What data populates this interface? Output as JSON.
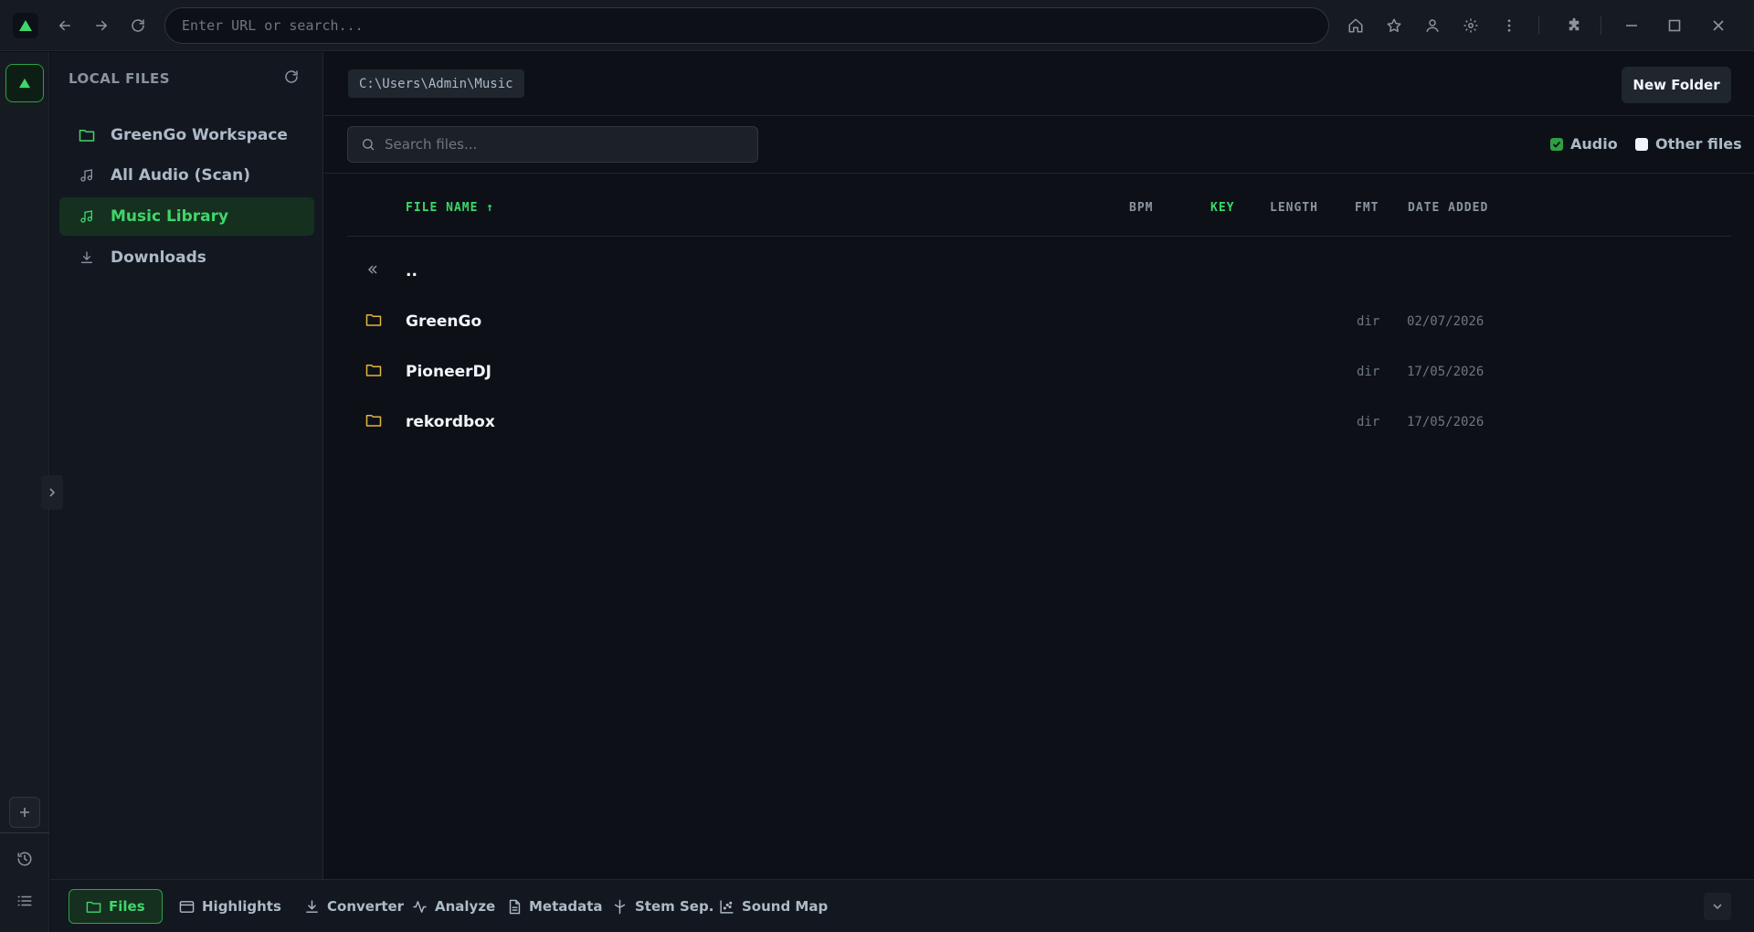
{
  "browser": {
    "url_placeholder": "Enter URL or search...",
    "icons": [
      "back-icon",
      "forward-icon",
      "reload-icon",
      "home-icon",
      "star-icon",
      "user-icon",
      "settings-icon",
      "more-icon",
      "extensions-icon",
      "minimize-icon",
      "maximize-icon",
      "close-icon"
    ]
  },
  "sidebar": {
    "title": "LOCAL FILES",
    "items": [
      {
        "label": "GreenGo Workspace",
        "icon": "folder-icon"
      },
      {
        "label": "All Audio (Scan)",
        "icon": "music-note-icon"
      },
      {
        "label": "Music Library",
        "icon": "music-note-icon",
        "active": true
      },
      {
        "label": "Downloads",
        "icon": "download-icon"
      }
    ]
  },
  "main": {
    "path": "C:\\Users\\Admin\\Music",
    "new_folder_label": "New Folder",
    "search_placeholder": "Search files...",
    "filters": [
      {
        "label": "Audio",
        "checked": true
      },
      {
        "label": "Other files",
        "checked": false
      }
    ],
    "columns": {
      "name": "FILE NAME ↑",
      "bpm": "BPM",
      "key": "KEY",
      "length": "LENGTH",
      "fmt": "FMT",
      "date": "DATE ADDED"
    },
    "parent_row": "..",
    "rows": [
      {
        "name": "GreenGo",
        "fmt": "dir",
        "date": "02/07/2026"
      },
      {
        "name": "PioneerDJ",
        "fmt": "dir",
        "date": "17/05/2026"
      },
      {
        "name": "rekordbox",
        "fmt": "dir",
        "date": "17/05/2026"
      }
    ]
  },
  "bottombar": {
    "tabs": [
      {
        "label": "Files",
        "active": true
      },
      {
        "label": "Highlights"
      },
      {
        "label": "Converter"
      },
      {
        "label": "Analyze"
      },
      {
        "label": "Metadata"
      },
      {
        "label": "Stem Sep."
      },
      {
        "label": "Sound Map"
      }
    ]
  },
  "colors": {
    "accent": "#3fd66b",
    "folder": "#e3b341",
    "background": "#0d1117"
  }
}
